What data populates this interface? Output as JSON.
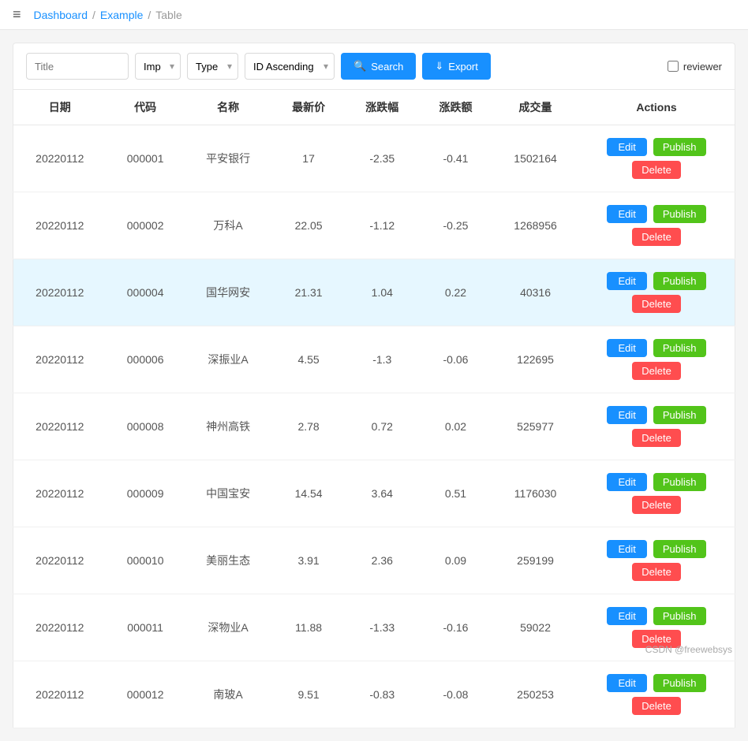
{
  "topbar": {
    "menu_icon": "≡",
    "breadcrumb": [
      {
        "label": "Dashboard",
        "href": "#",
        "active": true
      },
      {
        "label": "Example",
        "href": "#",
        "active": true
      },
      {
        "label": "Table",
        "href": "#",
        "active": false
      }
    ]
  },
  "toolbar": {
    "title_placeholder": "Title",
    "imp_label": "Imp",
    "type_label": "Type",
    "sort_label": "ID Ascending",
    "search_label": "Search",
    "export_label": "Export",
    "reviewer_label": "reviewer"
  },
  "table": {
    "headers": [
      "日期",
      "代码",
      "名称",
      "最新价",
      "涨跌幅",
      "涨跌额",
      "成交量",
      "Actions"
    ],
    "rows": [
      {
        "date": "20220112",
        "code": "000001",
        "name": "平安银行",
        "price": "17",
        "change_pct": "-2.35",
        "change_amt": "-0.41",
        "volume": "1502164",
        "highlighted": false
      },
      {
        "date": "20220112",
        "code": "000002",
        "name": "万科A",
        "price": "22.05",
        "change_pct": "-1.12",
        "change_amt": "-0.25",
        "volume": "1268956",
        "highlighted": false
      },
      {
        "date": "20220112",
        "code": "000004",
        "name": "国华网安",
        "price": "21.31",
        "change_pct": "1.04",
        "change_amt": "0.22",
        "volume": "40316",
        "highlighted": true
      },
      {
        "date": "20220112",
        "code": "000006",
        "name": "深振业A",
        "price": "4.55",
        "change_pct": "-1.3",
        "change_amt": "-0.06",
        "volume": "122695",
        "highlighted": false
      },
      {
        "date": "20220112",
        "code": "000008",
        "name": "神州高铁",
        "price": "2.78",
        "change_pct": "0.72",
        "change_amt": "0.02",
        "volume": "525977",
        "highlighted": false
      },
      {
        "date": "20220112",
        "code": "000009",
        "name": "中国宝安",
        "price": "14.54",
        "change_pct": "3.64",
        "change_amt": "0.51",
        "volume": "1176030",
        "highlighted": false
      },
      {
        "date": "20220112",
        "code": "000010",
        "name": "美丽生态",
        "price": "3.91",
        "change_pct": "2.36",
        "change_amt": "0.09",
        "volume": "259199",
        "highlighted": false
      },
      {
        "date": "20220112",
        "code": "000011",
        "name": "深物业A",
        "price": "11.88",
        "change_pct": "-1.33",
        "change_amt": "-0.16",
        "volume": "59022",
        "highlighted": false
      },
      {
        "date": "20220112",
        "code": "000012",
        "name": "南玻A",
        "price": "9.51",
        "change_pct": "-0.83",
        "change_amt": "-0.08",
        "volume": "250253",
        "highlighted": false
      }
    ],
    "actions": {
      "edit_label": "Edit",
      "publish_label": "Publish",
      "delete_label": "Delete"
    }
  },
  "watermark": "CSDN @freewebsys"
}
